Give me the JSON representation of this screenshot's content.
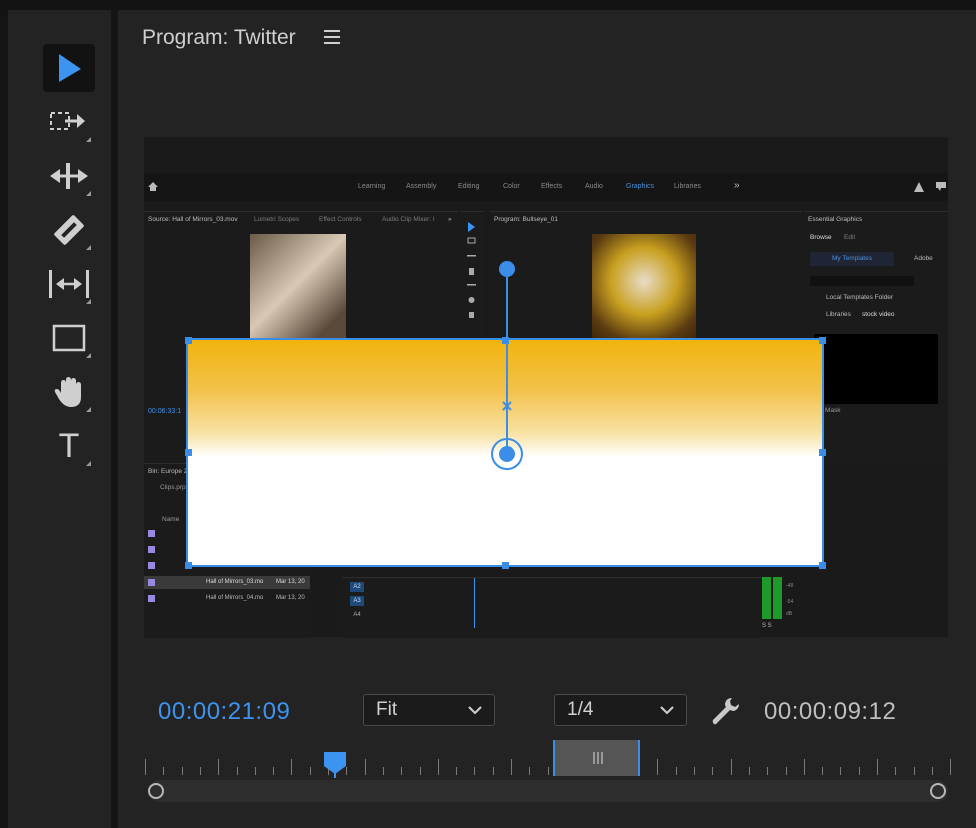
{
  "panel": {
    "title": "Program: Twitter"
  },
  "tools": [
    {
      "name": "selection-tool",
      "icon": "arrow-pointer-icon",
      "active": true
    },
    {
      "name": "track-select-tool",
      "icon": "track-select-forward-icon"
    },
    {
      "name": "ripple-edit-tool",
      "icon": "ripple-edit-icon"
    },
    {
      "name": "razor-tool",
      "icon": "razor-icon"
    },
    {
      "name": "slip-tool",
      "icon": "slip-icon"
    },
    {
      "name": "rectangle-tool",
      "icon": "rectangle-icon"
    },
    {
      "name": "hand-tool",
      "icon": "hand-icon"
    },
    {
      "name": "type-tool",
      "icon": "type-icon"
    }
  ],
  "tool_type_glyph": "T",
  "embedded": {
    "workspaces": [
      "Learning",
      "Assembly",
      "Editing",
      "Color",
      "Effects",
      "Audio",
      "Graphics",
      "Libraries"
    ],
    "active_workspace": "Graphics",
    "more": "»",
    "source_title": "Source: Hall of Mirrors_03.mov",
    "source_tabs": [
      "Lumetri Scopes",
      "Effect Controls",
      "Audio Clip Mixer: I"
    ],
    "source_more": "»",
    "source_tc": "00:06:33:1",
    "program_title": "Program: Bullseye_01",
    "eg_title": "Essential Graphics",
    "eg_tabs": [
      "Browse",
      "Edit"
    ],
    "my_templates": "My Templates",
    "adobe": "Adobe",
    "local_templates": "Local Templates Folder",
    "libraries": "Libraries",
    "libraries_value": "stock video",
    "mask_text": "t a Mask",
    "bin_title": "Bin: Europe 20",
    "bin_file": "Clips.prpr",
    "bin_col_name": "Name",
    "bin_rows": [
      {
        "name": "Hall of Mirrors_03.mo",
        "date": "Mar 13, 20"
      },
      {
        "name": "Hall of Mirrors_04.mo",
        "date": "Mar 13, 20"
      }
    ],
    "tracks": [
      "A2",
      "A3",
      "A4"
    ],
    "meter_label": "dB",
    "meter_values": [
      "-48",
      "-54"
    ],
    "meter_ss": "S S"
  },
  "controls": {
    "current_time": "00:00:21:09",
    "zoom_value": "Fit",
    "resolution_value": "1/4",
    "duration": "00:00:09:12"
  },
  "colors": {
    "accent": "#3d93f0",
    "handle": "#3b8ee8",
    "gradient_top": "#f1b40c"
  }
}
